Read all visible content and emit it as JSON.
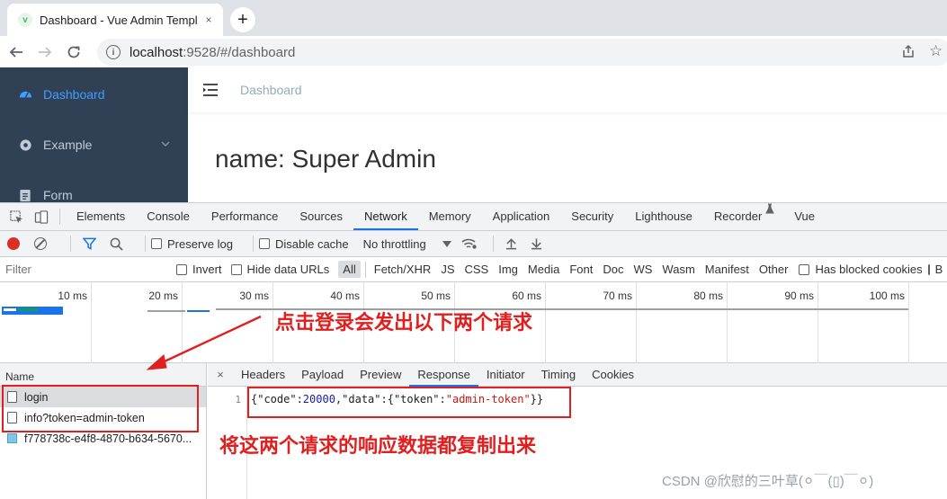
{
  "browser": {
    "tab_title": "Dashboard - Vue Admin Templ",
    "favicon_letter": "v",
    "tab_close": "×",
    "new_tab": "+",
    "url_host": "localhost",
    "url_path": ":9528/#/dashboard"
  },
  "app": {
    "sidebar": [
      {
        "label": "Dashboard",
        "icon": "dashboard-icon",
        "active": true
      },
      {
        "label": "Example",
        "icon": "example-icon",
        "active": false
      },
      {
        "label": "Form",
        "icon": "form-icon",
        "active": false
      }
    ],
    "breadcrumb": "Dashboard",
    "dashboard_text": "name: Super Admin"
  },
  "devtools": {
    "tabs": [
      "Elements",
      "Console",
      "Performance",
      "Sources",
      "Network",
      "Memory",
      "Application",
      "Security",
      "Lighthouse",
      "Recorder",
      "Vue"
    ],
    "active_tab": "Network",
    "toolbar": {
      "preserve_log": "Preserve log",
      "disable_cache": "Disable cache",
      "throttling": "No throttling"
    },
    "filter_placeholder": "Filter",
    "filter_options": {
      "invert": "Invert",
      "hide_data_urls": "Hide data URLs"
    },
    "type_filters": [
      "All",
      "Fetch/XHR",
      "JS",
      "CSS",
      "Img",
      "Media",
      "Font",
      "Doc",
      "WS",
      "Wasm",
      "Manifest",
      "Other"
    ],
    "blocked_cookies": "Has blocked cookies",
    "blocked_cut": "B",
    "timeline_ticks": [
      "10 ms",
      "20 ms",
      "30 ms",
      "40 ms",
      "50 ms",
      "60 ms",
      "70 ms",
      "80 ms",
      "90 ms",
      "100 ms"
    ],
    "name_header": "Name",
    "requests": [
      {
        "name": "login",
        "selected": true,
        "type": "doc"
      },
      {
        "name": "info?token=admin-token",
        "selected": false,
        "type": "doc"
      },
      {
        "name": "f778738c-e4f8-4870-b634-5670...",
        "selected": false,
        "type": "img"
      }
    ],
    "detail_close": "×",
    "detail_tabs": [
      "Headers",
      "Payload",
      "Preview",
      "Response",
      "Initiator",
      "Timing",
      "Cookies"
    ],
    "active_detail_tab": "Response",
    "response": {
      "line_number": "1",
      "p1": "{\"code\":",
      "code_value": "20000",
      "p2": ",\"data\":{\"token\":",
      "token_value": "\"admin-token\"",
      "p3": "}}"
    }
  },
  "annotations": {
    "arrow_text": "点击登录会发出以下两个请求",
    "bottom_text": "将这两个请求的响应数据都复制出来",
    "accent_color": "#e02020"
  },
  "watermark": "CSDN @欣慰的三叶草(⚪￣(▯)￣⚪)"
}
